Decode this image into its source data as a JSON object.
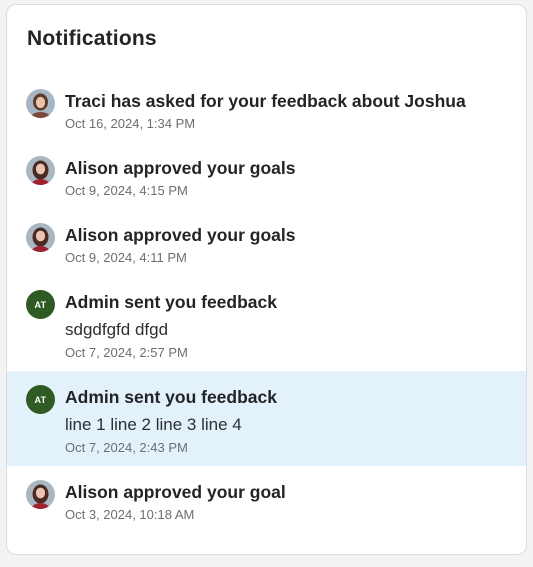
{
  "panel": {
    "title": "Notifications"
  },
  "notifications": [
    {
      "title": "Traci has asked for your feedback about Joshua",
      "body": "",
      "time": "Oct 16, 2024, 1:34 PM",
      "avatar_type": "photo-traci",
      "avatar_initials": ""
    },
    {
      "title": "Alison approved your goals",
      "body": "",
      "time": "Oct 9, 2024, 4:15 PM",
      "avatar_type": "photo-alison",
      "avatar_initials": ""
    },
    {
      "title": "Alison approved your goals",
      "body": "",
      "time": "Oct 9, 2024, 4:11 PM",
      "avatar_type": "photo-alison",
      "avatar_initials": ""
    },
    {
      "title": "Admin sent you feedback",
      "body": "sdgdfgfd dfgd",
      "time": "Oct 7, 2024, 2:57 PM",
      "avatar_type": "initials",
      "avatar_initials": "AT"
    },
    {
      "title": "Admin sent you feedback",
      "body": "line 1 line 2 line 3 line 4",
      "time": "Oct 7, 2024, 2:43 PM",
      "avatar_type": "initials",
      "avatar_initials": "AT",
      "selected": true
    },
    {
      "title": "Alison approved your goal",
      "body": "",
      "time": "Oct 3, 2024, 10:18 AM",
      "avatar_type": "photo-alison",
      "avatar_initials": ""
    }
  ],
  "colors": {
    "selected_background": "#e3f1fb",
    "initials_avatar": "#2f5a24"
  }
}
